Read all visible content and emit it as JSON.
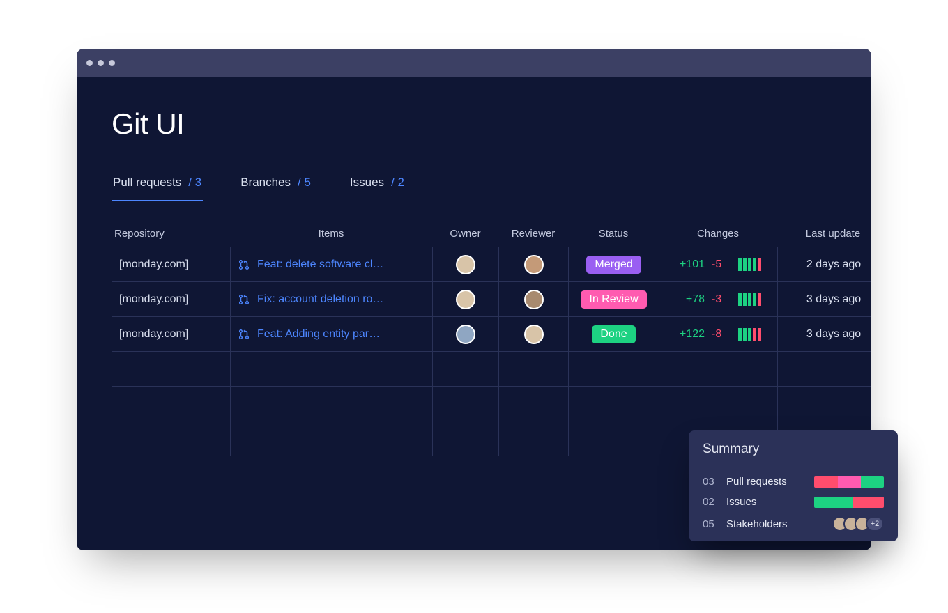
{
  "page": {
    "title": "Git UI"
  },
  "tabs": [
    {
      "label": "Pull requests",
      "count_display": "/ 3",
      "active": true
    },
    {
      "label": "Branches",
      "count_display": "/ 5",
      "active": false
    },
    {
      "label": "Issues",
      "count_display": "/ 2",
      "active": false
    }
  ],
  "columns": {
    "repository": "Repository",
    "items": "Items",
    "owner": "Owner",
    "reviewer": "Reviewer",
    "status": "Status",
    "changes": "Changes",
    "last_update": "Last update"
  },
  "rows": [
    {
      "repository": "[monday.com]",
      "item": "Feat: delete software cl…",
      "status_label": "Merged",
      "status_class": "status-merged",
      "additions": "+101",
      "deletions": "-5",
      "bars_green": 4,
      "bars_red": 1,
      "last_update": "2 days ago"
    },
    {
      "repository": "[monday.com]",
      "item": "Fix: account deletion ro…",
      "status_label": "In Review",
      "status_class": "status-inreview",
      "additions": "+78",
      "deletions": "-3",
      "bars_green": 4,
      "bars_red": 1,
      "last_update": "3 days ago"
    },
    {
      "repository": "[monday.com]",
      "item": "Feat: Adding entity par…",
      "status_label": "Done",
      "status_class": "status-done",
      "additions": "+122",
      "deletions": "-8",
      "bars_green": 3,
      "bars_red": 2,
      "last_update": "3 days ago"
    }
  ],
  "summary": {
    "title": "Summary",
    "rows": [
      {
        "num": "03",
        "label": "Pull requests",
        "segments": [
          {
            "color": "#ff4d6d",
            "pct": 34
          },
          {
            "color": "#ff5bb0",
            "pct": 33
          },
          {
            "color": "#1dd282",
            "pct": 33
          }
        ]
      },
      {
        "num": "02",
        "label": "Issues",
        "segments": [
          {
            "color": "#1dd282",
            "pct": 55
          },
          {
            "color": "#ff4d6d",
            "pct": 45
          }
        ]
      },
      {
        "num": "05",
        "label": "Stakeholders",
        "more": "+2"
      }
    ]
  }
}
